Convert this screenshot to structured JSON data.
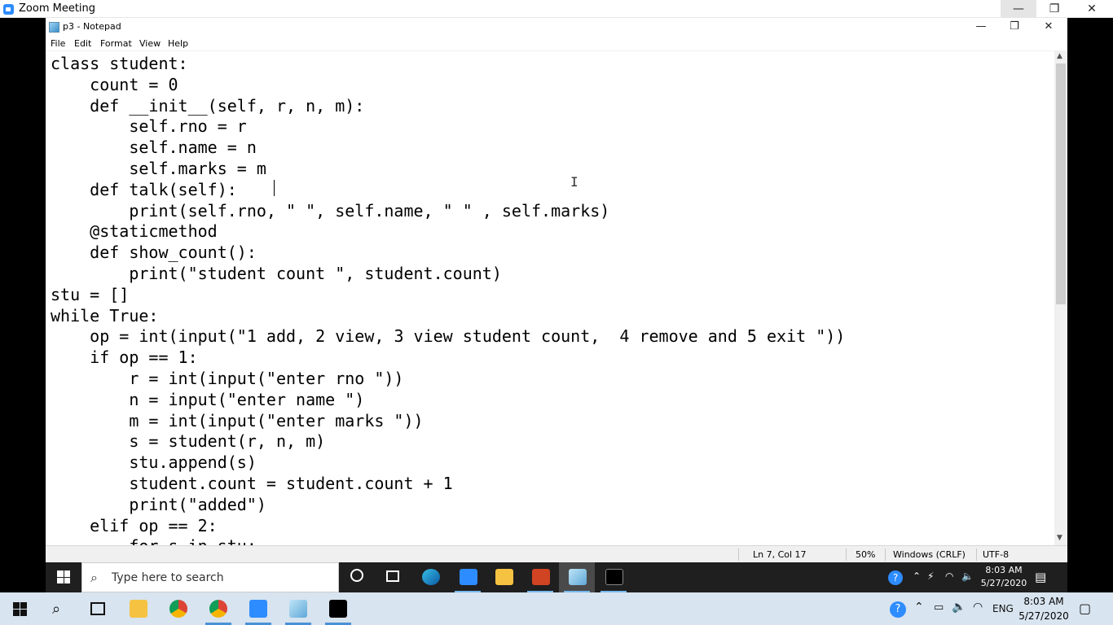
{
  "zoom": {
    "title": "Zoom Meeting",
    "controls": {
      "minimize": "—",
      "maximize": "❐",
      "close": "✕"
    }
  },
  "notepad": {
    "title": "p3 - Notepad",
    "controls": {
      "minimize": "—",
      "maximize": "❐",
      "close": "✕"
    },
    "menu": [
      "File",
      "Edit",
      "Format",
      "View",
      "Help"
    ],
    "code": "class student:\n\tcount = 0\n\tdef __init__(self, r, n, m):\n\t\tself.rno = r\n\t\tself.name = n\n\t\tself.marks = m\n\tdef talk(self):\n\t\tprint(self.rno, \" \", self.name, \" \" , self.marks)\n\t@staticmethod\n\tdef show_count():\n\t\tprint(\"student count \", student.count)\nstu = []\nwhile True:\n\top = int(input(\"1 add, 2 view, 3 view student count,  4 remove and 5 exit \"))\n\tif op == 1:\n\t\tr = int(input(\"enter rno \"))\n\t\tn = input(\"enter name \")\n\t\tm = int(input(\"enter marks \"))\n\t\ts = student(r, n, m)\n\t\tstu.append(s)\n\t\tstudent.count = student.count + 1\n\t\tprint(\"added\")\n\telif op == 2:\n\t\tfor s in stu:",
    "status": {
      "position": "Ln 7, Col 17",
      "zoom": "50%",
      "line_ending": "Windows (CRLF)",
      "encoding": "UTF-8"
    }
  },
  "taskbar_inner": {
    "search_placeholder": "Type here to search",
    "time": "8:03 AM",
    "date": "5/27/2020",
    "icons": [
      "cortana-icon",
      "task-view-icon",
      "edge-icon",
      "zoom-icon",
      "file-explorer-icon",
      "powerpoint-icon",
      "notepad-icon",
      "cmd-icon"
    ]
  },
  "taskbar_outer": {
    "time": "8:03 AM",
    "date": "5/27/2020",
    "language": "ENG",
    "icons": [
      "search-icon",
      "task-view-icon",
      "file-explorer-icon",
      "chrome-icon",
      "chrome-icon",
      "zoom-icon",
      "notepad-icon",
      "cmd-icon"
    ]
  },
  "colors": {
    "zoom_blue": "#2d8cff",
    "taskbar_dark": "#1f1f1f",
    "taskbar_light": "#d8e4ef",
    "accent": "#76b9ed"
  }
}
